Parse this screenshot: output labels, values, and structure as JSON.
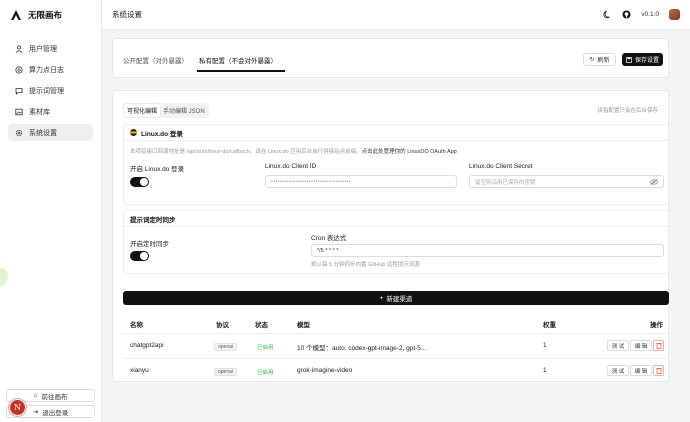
{
  "brand": {
    "title": "无限画布"
  },
  "sidebar": {
    "items": [
      {
        "label": "用户管理",
        "icon": "user-icon"
      },
      {
        "label": "算力点日志",
        "icon": "coin-icon"
      },
      {
        "label": "提示词管理",
        "icon": "message-icon"
      },
      {
        "label": "素材库",
        "icon": "image-icon"
      },
      {
        "label": "系统设置",
        "icon": "gear-icon",
        "active": true
      }
    ],
    "goto_canvas": "前往画布",
    "logout": "退出登录",
    "avatar_letter": "N"
  },
  "topbar": {
    "title": "系统设置",
    "version": "v0.1.0"
  },
  "config_tabs": {
    "public": "公开配置（对外暴露）",
    "private": "私有配置（不会对外暴露）",
    "refresh": "刷新",
    "save": "保存设置"
  },
  "editor": {
    "visual": "可视化编辑",
    "json": "手动编辑 JSON",
    "autosave_note": "该指配置只会在后台保存"
  },
  "linuxdo": {
    "title": "Linux.do 登录",
    "desc_prefix": "本项目接口回调地址是 /api/auth/linux-do/callback。请在 Linux.do 应用后台自行拼接站点前缀。",
    "desc_link": "点击此处管理你的 LinuxDO OAuth App",
    "enable_label": "开启 Linux.do 登录",
    "client_id_label": "Linux.do Client ID",
    "client_id_value": "••••••••••••••••••••••••••••••••••••",
    "client_secret_label": "Linux.do Client Secret",
    "client_secret_placeholder": "留空则沿用已保存的密钥"
  },
  "prompt_sync": {
    "title": "提示词定时同步",
    "enable_label": "开启定时同步",
    "cron_label": "Cron 表达式",
    "cron_value": "*/5 * * * *",
    "hint": "默认每 5 分钟同步内置 GitHub 远程提示词源"
  },
  "channels": {
    "new_button": "新建渠道",
    "headers": {
      "name": "名称",
      "protocol": "协议",
      "status": "状态",
      "model": "模型",
      "weight": "权重",
      "ops": "操作"
    },
    "rows": [
      {
        "name": "chatgpt2api",
        "protocol": "openai",
        "status": "已启用",
        "model": "10 个模型：auto, codex-gpt-image-2, gpt-5...",
        "weight": "1",
        "test": "测 试",
        "edit": "编 辑"
      },
      {
        "name": "xianyu",
        "protocol": "openai",
        "status": "已启用",
        "model": "grok-imagine-video",
        "weight": "1",
        "test": "测 试",
        "edit": "编 辑"
      }
    ]
  },
  "colors": {
    "accent": "#111111",
    "status_green": "#3fb34f",
    "danger": "#e05555"
  }
}
